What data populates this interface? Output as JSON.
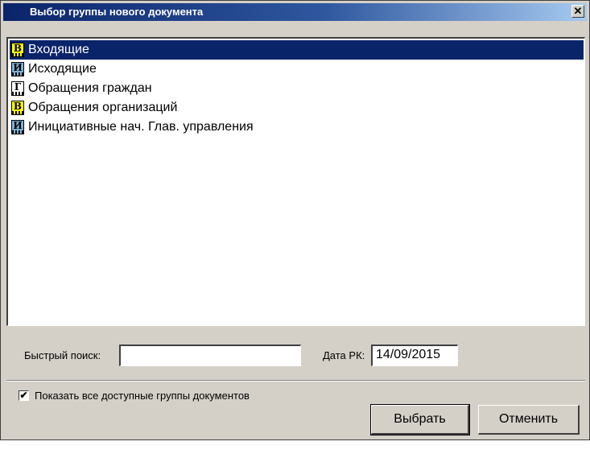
{
  "window": {
    "title": "Выбор группы нового документа",
    "close_glyph": "✕"
  },
  "groups": [
    {
      "label": "Входящие",
      "icon": "doc-group-in-icon",
      "glyph": "В",
      "icon_color": "#ffff00",
      "selected": true
    },
    {
      "label": "Исходящие",
      "icon": "doc-group-out-icon",
      "glyph": "И",
      "icon_color": "#7fb2d8",
      "selected": false
    },
    {
      "label": "Обращения граждан",
      "icon": "doc-group-citizens-icon",
      "glyph": "Г",
      "icon_color": "#ffffff",
      "selected": false
    },
    {
      "label": "Обращения организаций",
      "icon": "doc-group-in-icon",
      "glyph": "В",
      "icon_color": "#ffff00",
      "selected": false
    },
    {
      "label": "Инициативные нач. Глав. управления",
      "icon": "doc-group-out-icon",
      "glyph": "И",
      "icon_color": "#7fb2d8",
      "selected": false
    }
  ],
  "search": {
    "label": "Быстрый поиск:",
    "value": ""
  },
  "date": {
    "label": "Дата РК:",
    "value": "14/09/2015"
  },
  "show_all": {
    "label": "Показать все доступные группы документов",
    "checked": true,
    "check_glyph": "✔"
  },
  "buttons": {
    "select_label": "Выбрать",
    "cancel_label": "Отменить"
  }
}
